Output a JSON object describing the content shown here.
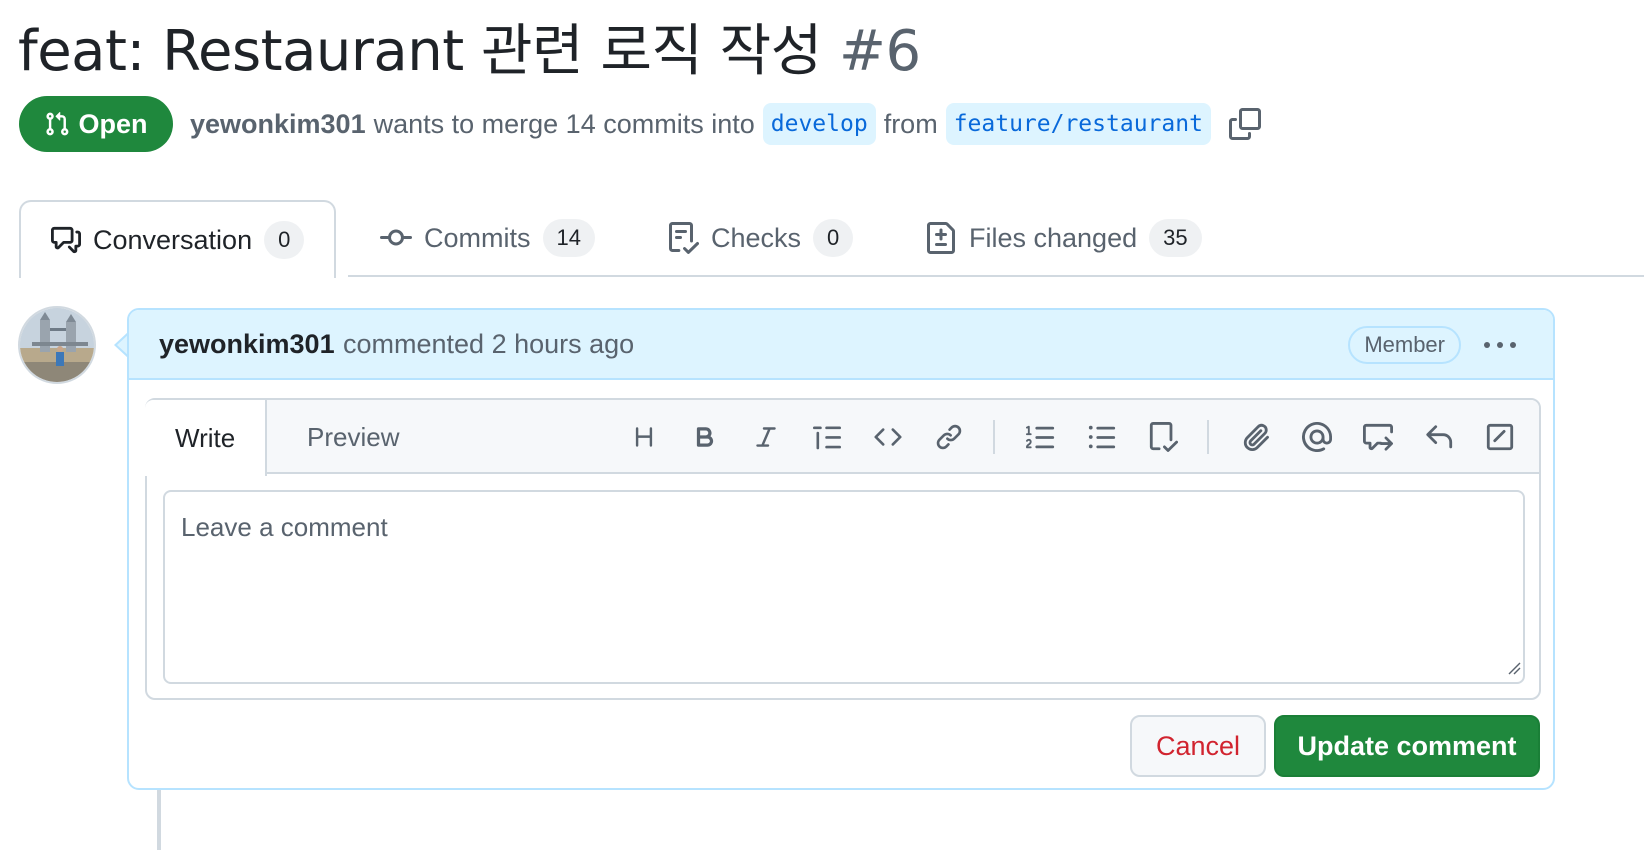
{
  "pr": {
    "title": "feat: Restaurant 관련 로직 작성",
    "number": "#6",
    "state": "Open",
    "author": "yewonkim301",
    "merge_text": "wants to merge 14 commits into",
    "base_branch": "develop",
    "from_text": "from",
    "head_branch": "feature/restaurant"
  },
  "tabs": [
    {
      "label": "Conversation",
      "count": "0",
      "icon": "comment-discussion-icon"
    },
    {
      "label": "Commits",
      "count": "14",
      "icon": "git-commit-icon"
    },
    {
      "label": "Checks",
      "count": "0",
      "icon": "checklist-icon"
    },
    {
      "label": "Files changed",
      "count": "35",
      "icon": "file-diff-icon"
    }
  ],
  "comment": {
    "author": "yewonkim301",
    "action_time": "commented 2 hours ago",
    "role": "Member"
  },
  "editor": {
    "write_tab": "Write",
    "preview_tab": "Preview",
    "placeholder": "Leave a comment",
    "tools": [
      "heading-icon",
      "bold-icon",
      "italic-icon",
      "quote-icon",
      "code-icon",
      "link-icon",
      "ordered-list-icon",
      "unordered-list-icon",
      "task-list-icon",
      "attach-icon",
      "mention-icon",
      "reference-icon",
      "reply-icon",
      "slash-commands-icon"
    ]
  },
  "actions": {
    "cancel": "Cancel",
    "update": "Update comment"
  },
  "colors": {
    "open_green": "#1f883d",
    "link_blue": "#0969da",
    "branch_bg": "#ddf4ff",
    "cancel_red": "#d1242f",
    "header_blue": "#ddf4ff"
  }
}
